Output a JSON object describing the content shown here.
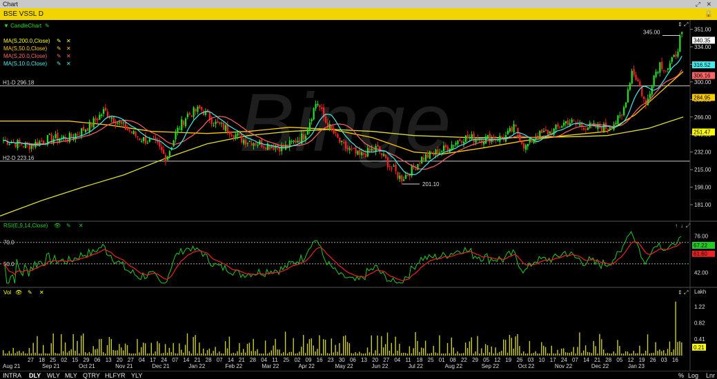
{
  "window": {
    "title": "Chart"
  },
  "symbol": "BSE VSSL D",
  "watermark": "Binge",
  "indicators": [
    {
      "label": "CandleChart",
      "color": "#22dd22"
    },
    {
      "label": "MA(S,200.0,Close)",
      "color": "#ffff00"
    },
    {
      "label": "MA(S,50.0,Close)",
      "color": "#ffcc00"
    },
    {
      "label": "MA(S,20.0,Close)",
      "color": "#ff6666"
    },
    {
      "label": "MA(S,10.0,Close)",
      "color": "#44eeee"
    }
  ],
  "hlines": {
    "h1": "H1-D 296.18",
    "h2": "H2-D 223.16",
    "h1_value": 296.18,
    "h2_value": 223.16
  },
  "annotations": {
    "high": "345.00",
    "low": "201.10",
    "high_value": 345.0,
    "low_value": 201.1
  },
  "price_badges": [
    {
      "text": "340.35",
      "value": 340.35,
      "bg": "#ffffff",
      "fg": "#000000"
    },
    {
      "text": "316.52",
      "value": 316.52,
      "bg": "#44eeee",
      "fg": "#000000"
    },
    {
      "text": "306.16",
      "value": 306.16,
      "bg": "#ff6666",
      "fg": "#000000"
    },
    {
      "text": "284.95",
      "value": 284.95,
      "bg": "#ffcc00",
      "fg": "#000000"
    },
    {
      "text": "251.47",
      "value": 251.47,
      "bg": "#ffff00",
      "fg": "#000000"
    }
  ],
  "rsi": {
    "label": "RSI(E,9,14,Close)",
    "level_high": "70.0",
    "level_low": "50.0",
    "badge_rsi": "67.22",
    "badge_sig": "61.60"
  },
  "volume": {
    "label": "Vol",
    "unit": "Lakh",
    "badge": "0.21"
  },
  "timeframes": [
    "INTRA",
    "DLY",
    "WLY",
    "MLY",
    "QTRY",
    "HLFYR",
    "YLY"
  ],
  "active_timeframe": "DLY",
  "bottom_right": [
    "%",
    "Log",
    "Lnr"
  ],
  "chart_data": [
    {
      "type": "candlestick",
      "title": "BSE VSSL D",
      "ylim": [
        165,
        360
      ],
      "yticks": [
        "351.00",
        "334.00",
        "317.00",
        "300.00",
        "283.00",
        "266.00",
        "249.00",
        "232.00",
        "215.00",
        "198.00",
        "181.00"
      ],
      "xticks_days": [
        "27",
        "18",
        "25",
        "02",
        "15",
        "29",
        "06",
        "13",
        "20",
        "27",
        "04",
        "17",
        "24",
        "07",
        "14",
        "21",
        "28",
        "07",
        "14",
        "21",
        "28",
        "04",
        "11",
        "25",
        "02",
        "09",
        "16",
        "23",
        "30",
        "06",
        "13",
        "20",
        "27",
        "04",
        "11",
        "18",
        "25",
        "01",
        "08",
        "22",
        "29",
        "05",
        "12",
        "19",
        "26",
        "03",
        "10",
        "17",
        "24",
        "07",
        "14",
        "21",
        "28",
        "05",
        "12",
        "19",
        "26",
        "03",
        "16"
      ],
      "xticks_months": [
        "Aug 21",
        "Sep 21",
        "Oct 21",
        "Nov 21",
        "Dec 21",
        "Jan 22",
        "Feb 22",
        "Mar 22",
        "Apr 22",
        "May 22",
        "Jun 22",
        "Jul 22",
        "Aug 22",
        "Sep 22",
        "Oct 22",
        "Nov 22",
        "Dec 22",
        "Jan 23"
      ],
      "series": [
        {
          "name": "MA(S,200.0,Close)",
          "trend": [
            [
              0,
              170
            ],
            [
              60,
              185
            ],
            [
              120,
              198
            ],
            [
              180,
              210
            ],
            [
              240,
              226
            ],
            [
              300,
              240
            ],
            [
              360,
              248
            ],
            [
              420,
              252
            ],
            [
              480,
              254
            ],
            [
              540,
              252
            ],
            [
              600,
              248
            ],
            [
              680,
              246
            ],
            [
              760,
              246
            ],
            [
              840,
              247
            ],
            [
              880,
              248
            ],
            [
              940,
              255
            ],
            [
              990,
              266
            ]
          ]
        },
        {
          "name": "MA(S,50.0,Close)",
          "trend": [
            [
              0,
              262
            ],
            [
              100,
              262
            ],
            [
              160,
              258
            ],
            [
              220,
              252
            ],
            [
              300,
              250
            ],
            [
              360,
              252
            ],
            [
              420,
              256
            ],
            [
              480,
              254
            ],
            [
              540,
              246
            ],
            [
              600,
              232
            ],
            [
              640,
              230
            ],
            [
              700,
              236
            ],
            [
              760,
              243
            ],
            [
              820,
              248
            ],
            [
              880,
              252
            ],
            [
              920,
              268
            ],
            [
              960,
              292
            ],
            [
              990,
              310
            ]
          ]
        },
        {
          "name": "MA(S,20.0,Close)"
        },
        {
          "name": "MA(S,10.0,Close)"
        }
      ]
    },
    {
      "type": "line",
      "title": "RSI(E,9,14,Close)",
      "ylim": [
        30,
        82
      ],
      "yticks": [
        "76.00",
        "59.00",
        "42.00"
      ],
      "series": [
        {
          "name": "RSI"
        },
        {
          "name": "Signal"
        }
      ]
    },
    {
      "type": "bar",
      "title": "Vol",
      "ylabel": "Lakh",
      "ylim": [
        0,
        1.5
      ],
      "yticks": [
        "1.22",
        "0.82",
        "0.41",
        "0.21"
      ],
      "last_spike": 1.35
    }
  ]
}
